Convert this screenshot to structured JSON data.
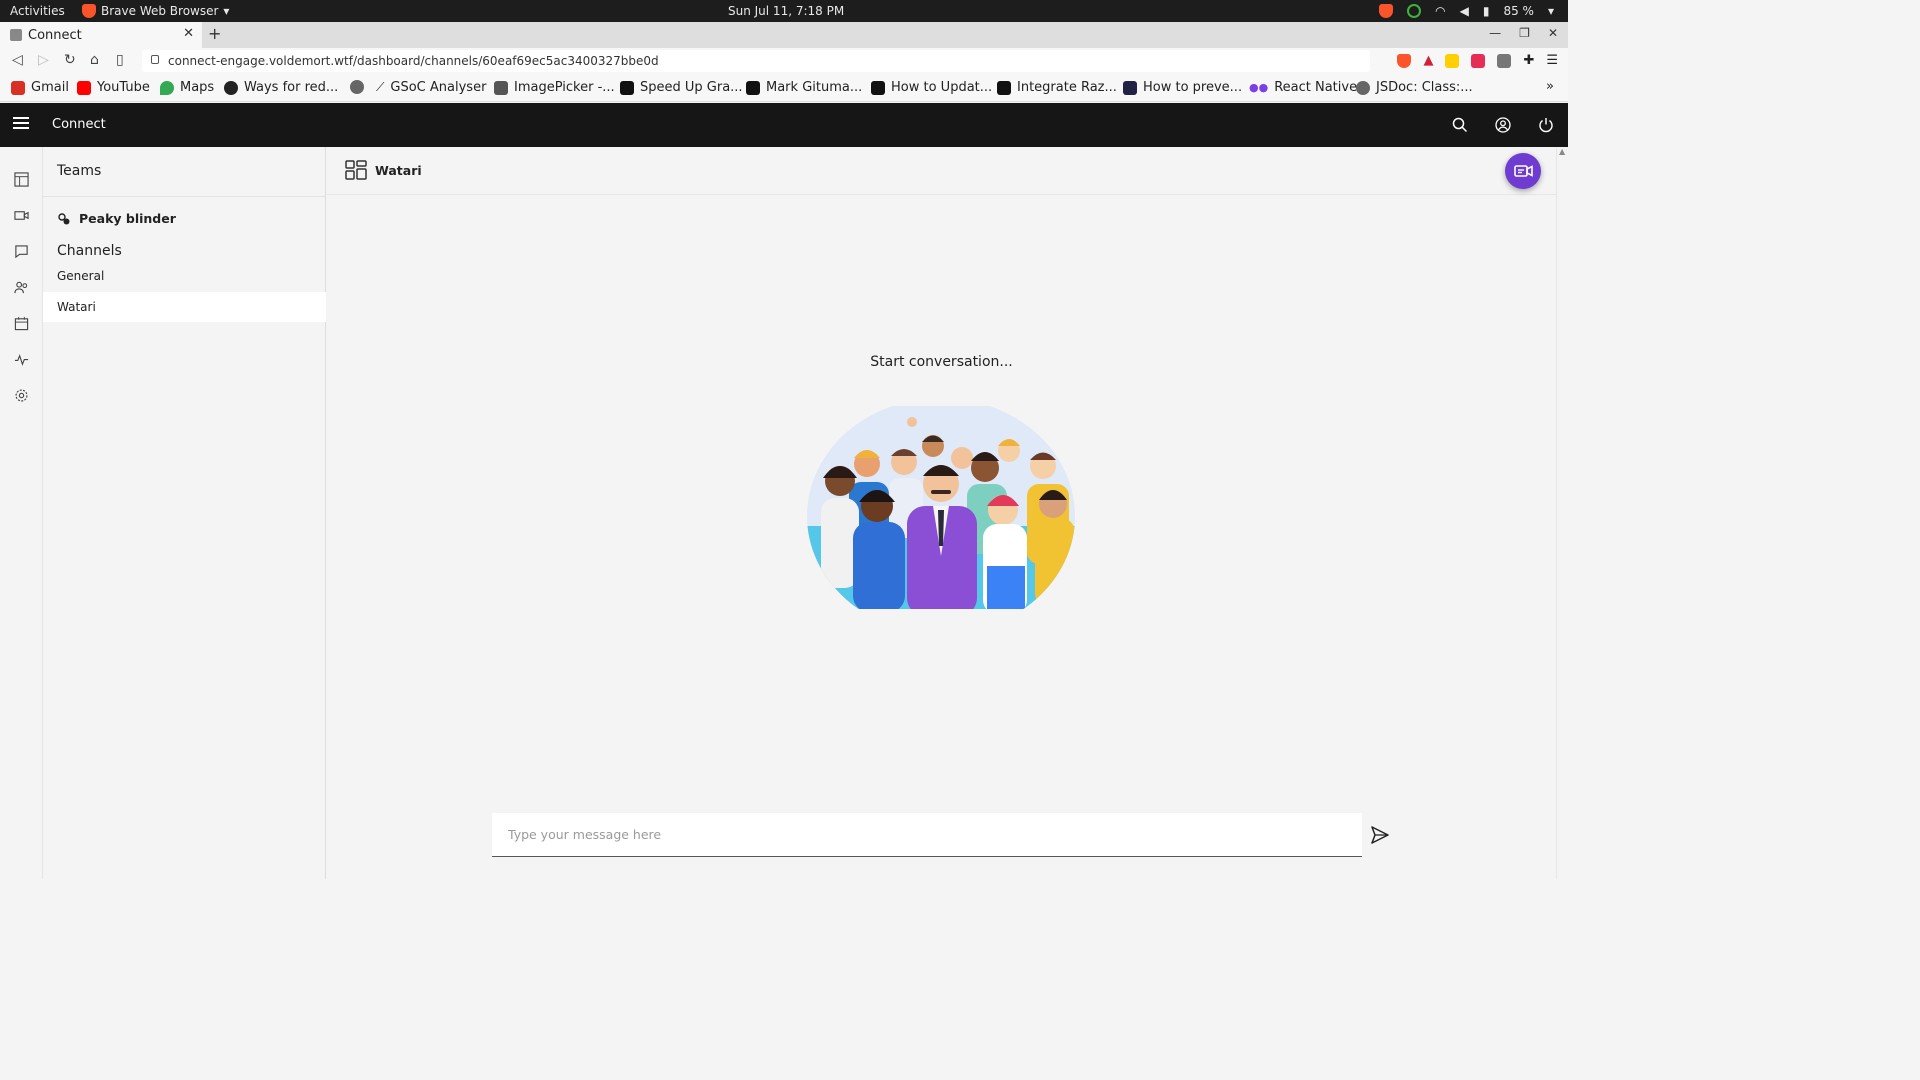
{
  "system_bar": {
    "activities": "Activities",
    "app_name": "Brave Web Browser",
    "clock": "Sun Jul 11,  7:18 PM",
    "battery": "85 %"
  },
  "browser": {
    "tab_title": "Connect",
    "url": "connect-engage.voldemort.wtf/dashboard/channels/60eaf69ec5ac3400327bbe0d",
    "bookmarks": [
      {
        "label": "Gmail",
        "icon": "gmail-icon",
        "color": "#d93025"
      },
      {
        "label": "YouTube",
        "icon": "youtube-icon",
        "color": "#ff0000"
      },
      {
        "label": "Maps",
        "icon": "maps-icon",
        "color": "#34a853"
      },
      {
        "label": "Ways for red...",
        "icon": "site-icon",
        "color": "#222222"
      },
      {
        "label": "",
        "icon": "globe-icon",
        "color": "#555555"
      },
      {
        "label": "GSoC Analyser",
        "icon": "chart-icon",
        "color": "#444444"
      },
      {
        "label": "ImagePicker -...",
        "icon": "expo-icon",
        "color": "#333333"
      },
      {
        "label": "Speed Up Gra...",
        "icon": "medium-icon",
        "color": "#111111"
      },
      {
        "label": "Mark Gituma...",
        "icon": "medium-icon",
        "color": "#111111"
      },
      {
        "label": "How to Updat...",
        "icon": "dev-icon",
        "color": "#111111"
      },
      {
        "label": "Integrate Raz...",
        "icon": "dev-icon",
        "color": "#111111"
      },
      {
        "label": "How to preve...",
        "icon": "site-icon",
        "color": "#222244"
      },
      {
        "label": "React Native",
        "icon": "dots-icon",
        "color": "#7b3fe4"
      },
      {
        "label": "JSDoc: Class:...",
        "icon": "globe-icon",
        "color": "#555555"
      }
    ]
  },
  "app": {
    "title": "Connect",
    "accent": "#6e3cd1",
    "header_bg": "#161616"
  },
  "sidebar": {
    "teams_title": "Teams",
    "team_name": "Peaky blinder",
    "channels_title": "Channels",
    "channels": [
      {
        "label": "General",
        "active": false
      },
      {
        "label": "Watari",
        "active": true
      }
    ]
  },
  "main": {
    "channel_name": "Watari",
    "empty_text": "Start conversation...",
    "composer_placeholder": "Type your message here"
  }
}
